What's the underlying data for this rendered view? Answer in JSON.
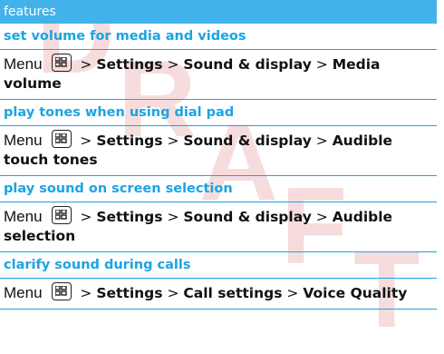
{
  "watermark": "DRAFT",
  "header": "features",
  "sections": [
    {
      "title": "set volume for media and videos",
      "menu_word": "Menu",
      "path": [
        "Settings",
        "Sound & display",
        "Media volume"
      ]
    },
    {
      "title": "play tones when using dial pad",
      "menu_word": "Menu",
      "path": [
        "Settings",
        "Sound & display",
        "Audible touch tones"
      ]
    },
    {
      "title": "play sound on screen selection",
      "menu_word": "Menu",
      "path": [
        "Settings",
        "Sound & display",
        "Audible selection"
      ]
    },
    {
      "title": "clarify sound during calls",
      "menu_word": "Menu",
      "path": [
        "Settings",
        "Call settings",
        "Voice Quality"
      ]
    }
  ],
  "separator": ">",
  "colors": {
    "header_bg": "#42b2ea",
    "accent": "#1aa4e4",
    "watermark": "#f6dcdc"
  },
  "icons": {
    "menu_key": "menu-key-icon"
  }
}
